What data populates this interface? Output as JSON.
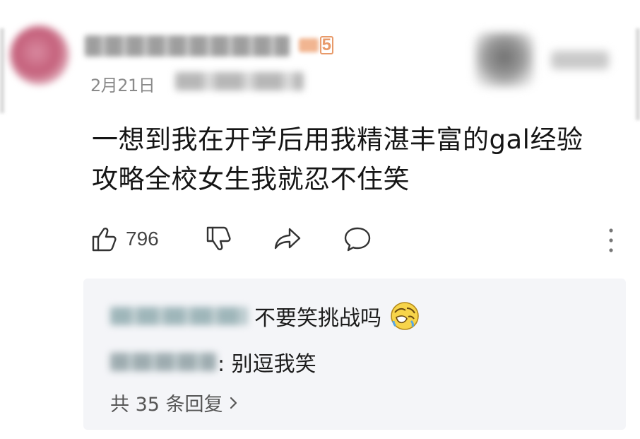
{
  "comment": {
    "date": "2月21日",
    "level": "5",
    "content_lines": [
      "一想到我在开学后用我精湛丰富的gal经验",
      "攻略全校女生我就忍不住笑"
    ],
    "icons": [
      "thumbs-up-icon",
      "thumbs-down-icon",
      "share-icon",
      "comment-icon",
      "more-icon"
    ],
    "like_count": "796"
  },
  "replies": {
    "items": [
      {
        "text": "不要笑挑战吗",
        "emoji": "laughing-emoji-icon"
      },
      {
        "text": ": 别逗我笑"
      }
    ],
    "count_label": "共 35 条回复"
  },
  "colors": {
    "text": "#1f1f1f",
    "muted": "#8a8a8a",
    "reply_bg": "#f4f5f8",
    "level_badge": "#e89a6a"
  }
}
